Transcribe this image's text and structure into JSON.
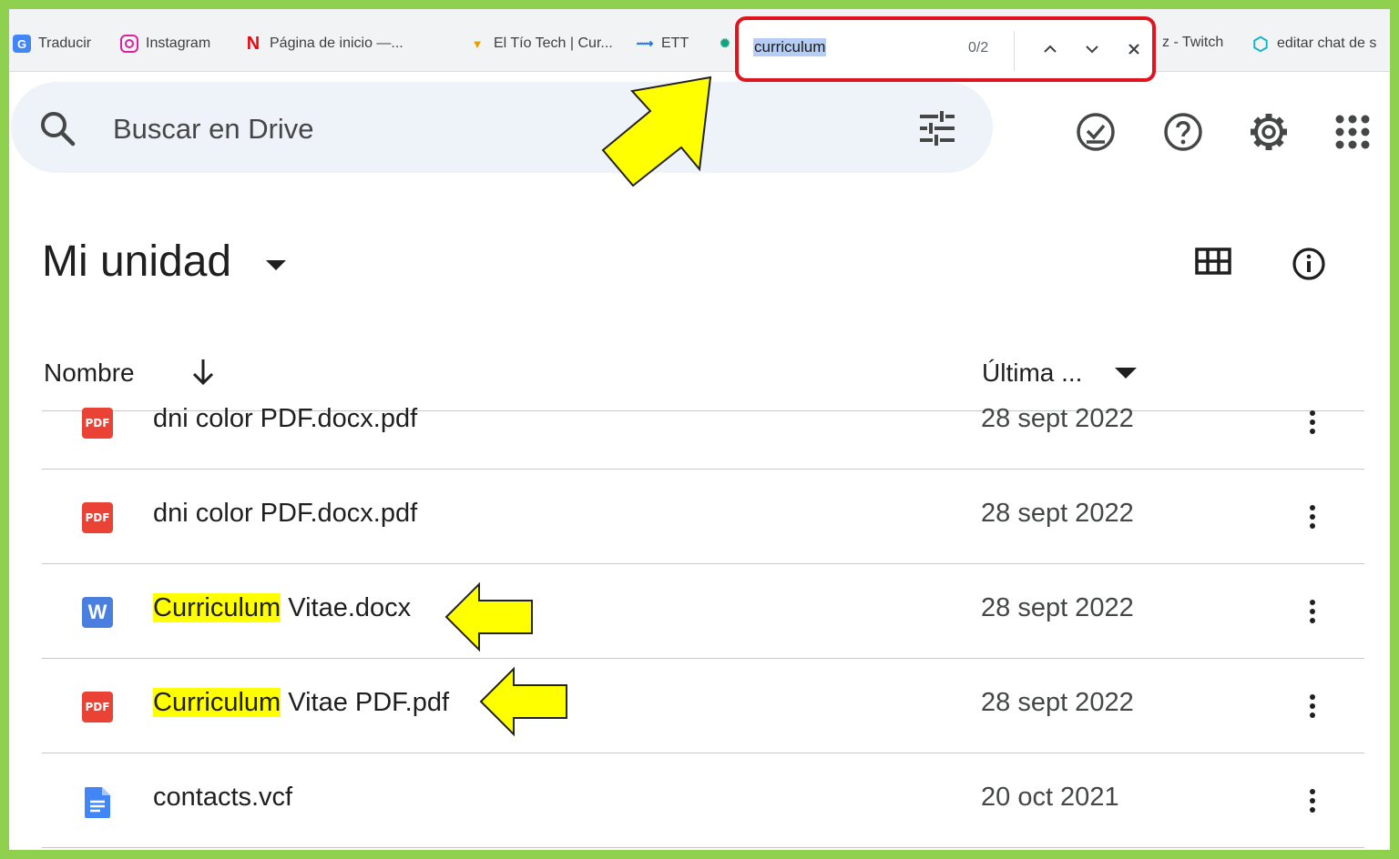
{
  "bookmarks": [
    {
      "label": "Traducir",
      "icon": "google-translate-icon"
    },
    {
      "label": "Instagram",
      "icon": "instagram-icon"
    },
    {
      "label": "Página de inicio —...",
      "icon": "netflix-icon"
    },
    {
      "label": "El Tío Tech | Cur...",
      "icon": "medal-icon"
    },
    {
      "label": "ETT",
      "icon": "ett-icon"
    },
    {
      "label": "z - Twitch",
      "icon": "twitch-icon"
    },
    {
      "label": "editar chat de s",
      "icon": "hexagon-icon"
    }
  ],
  "find_bar": {
    "query": "curriculum",
    "count": "0/2"
  },
  "search": {
    "placeholder": "Buscar en Drive"
  },
  "page": {
    "title": "Mi unidad"
  },
  "columns": {
    "name": "Nombre",
    "date": "Última ..."
  },
  "files": [
    {
      "name_highlight": "",
      "name_rest": "dni color PDF.docx.pdf",
      "date": "28 sept 2022",
      "type": "pdf"
    },
    {
      "name_highlight": "",
      "name_rest": "dni color PDF.docx.pdf",
      "date": "28 sept 2022",
      "type": "pdf"
    },
    {
      "name_highlight": "Curriculum",
      "name_rest": " Vitae.docx",
      "date": "28 sept 2022",
      "type": "word"
    },
    {
      "name_highlight": "Curriculum",
      "name_rest": " Vitae PDF.pdf",
      "date": "28 sept 2022",
      "type": "pdf"
    },
    {
      "name_highlight": "",
      "name_rest": "contacts.vcf",
      "date": "20 oct 2021",
      "type": "doc"
    }
  ],
  "icon_labels": {
    "pdf": "PDF",
    "word": "W"
  },
  "colors": {
    "frame_border": "#8fd14f",
    "find_highlight_border": "#e0141e",
    "highlight": "#ffff00",
    "annotation_arrow": "#ffff00"
  }
}
